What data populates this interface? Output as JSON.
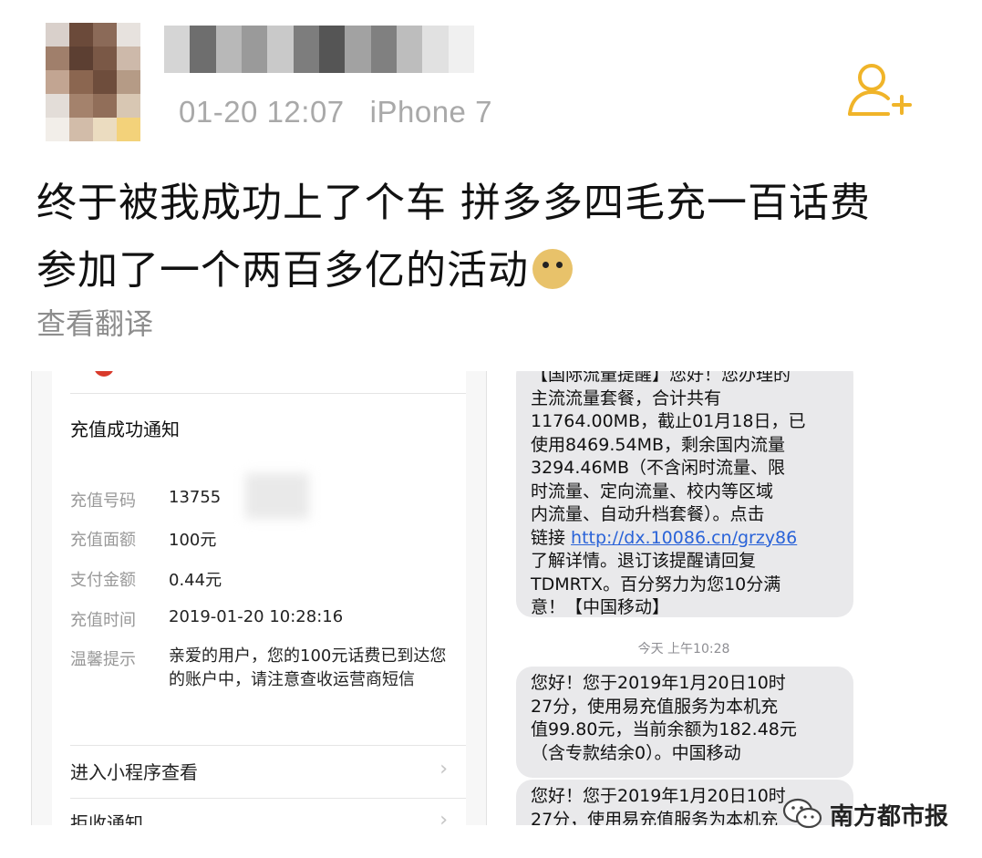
{
  "post": {
    "timestamp": "01-20 12:07",
    "device": "iPhone 7",
    "text_line1": "终于被我成功上了个车 拼多多四毛充一百话费",
    "text_line2": "参加了一个两百多亿的活动",
    "translate_link": "查看翻译",
    "follow_icon": "add-user-icon",
    "accent_color": "#f0b429"
  },
  "recharge_card": {
    "title": "充值成功通知",
    "rows": [
      {
        "label": "充值号码",
        "value": "13755"
      },
      {
        "label": "充值面额",
        "value": "100元"
      },
      {
        "label": "支付金额",
        "value": "0.44元"
      },
      {
        "label": "充值时间",
        "value": "2019-01-20 10:28:16"
      }
    ],
    "hint_label": "温馨提示",
    "hint_value": "亲爱的用户，您的100元话费已到达您的账户中，请注意查收运营商短信",
    "actions": [
      "进入小程序查看",
      "拒收通知"
    ]
  },
  "sms": {
    "bubble1_lines": [
      "【国际流量提醒】您好！您办理的",
      "主流流量套餐，合计共有",
      "11764.00MB，截止01月18日，已",
      "使用8469.54MB，剩余国内流量",
      "3294.46MB（不含闲时流量、限",
      "时流量、定向流量、校内等区域",
      "内流量、自动升档套餐）。点击"
    ],
    "link_prefix": "链接 ",
    "link": "http://dx.10086.cn/grzy86",
    "bubble1_tail": [
      "了解详情。退订该提醒请回复",
      "TDMRTX。百分努力为您10分满",
      "意！【中国移动】"
    ],
    "time_label": "今天 上午10:28",
    "bubble2_lines": [
      "您好！您于2019年1月20日10时",
      "27分，使用易充值服务为本机充",
      "值99.80元，当前余额为182.48元",
      "（含专款结余0）。中国移动"
    ],
    "bubble3_lines": [
      "您好！您于2019年1月20日10时",
      "27分，使用易充值服务为本机充"
    ]
  },
  "watermark": {
    "text": "南方都市报",
    "icon": "wechat-icon"
  }
}
